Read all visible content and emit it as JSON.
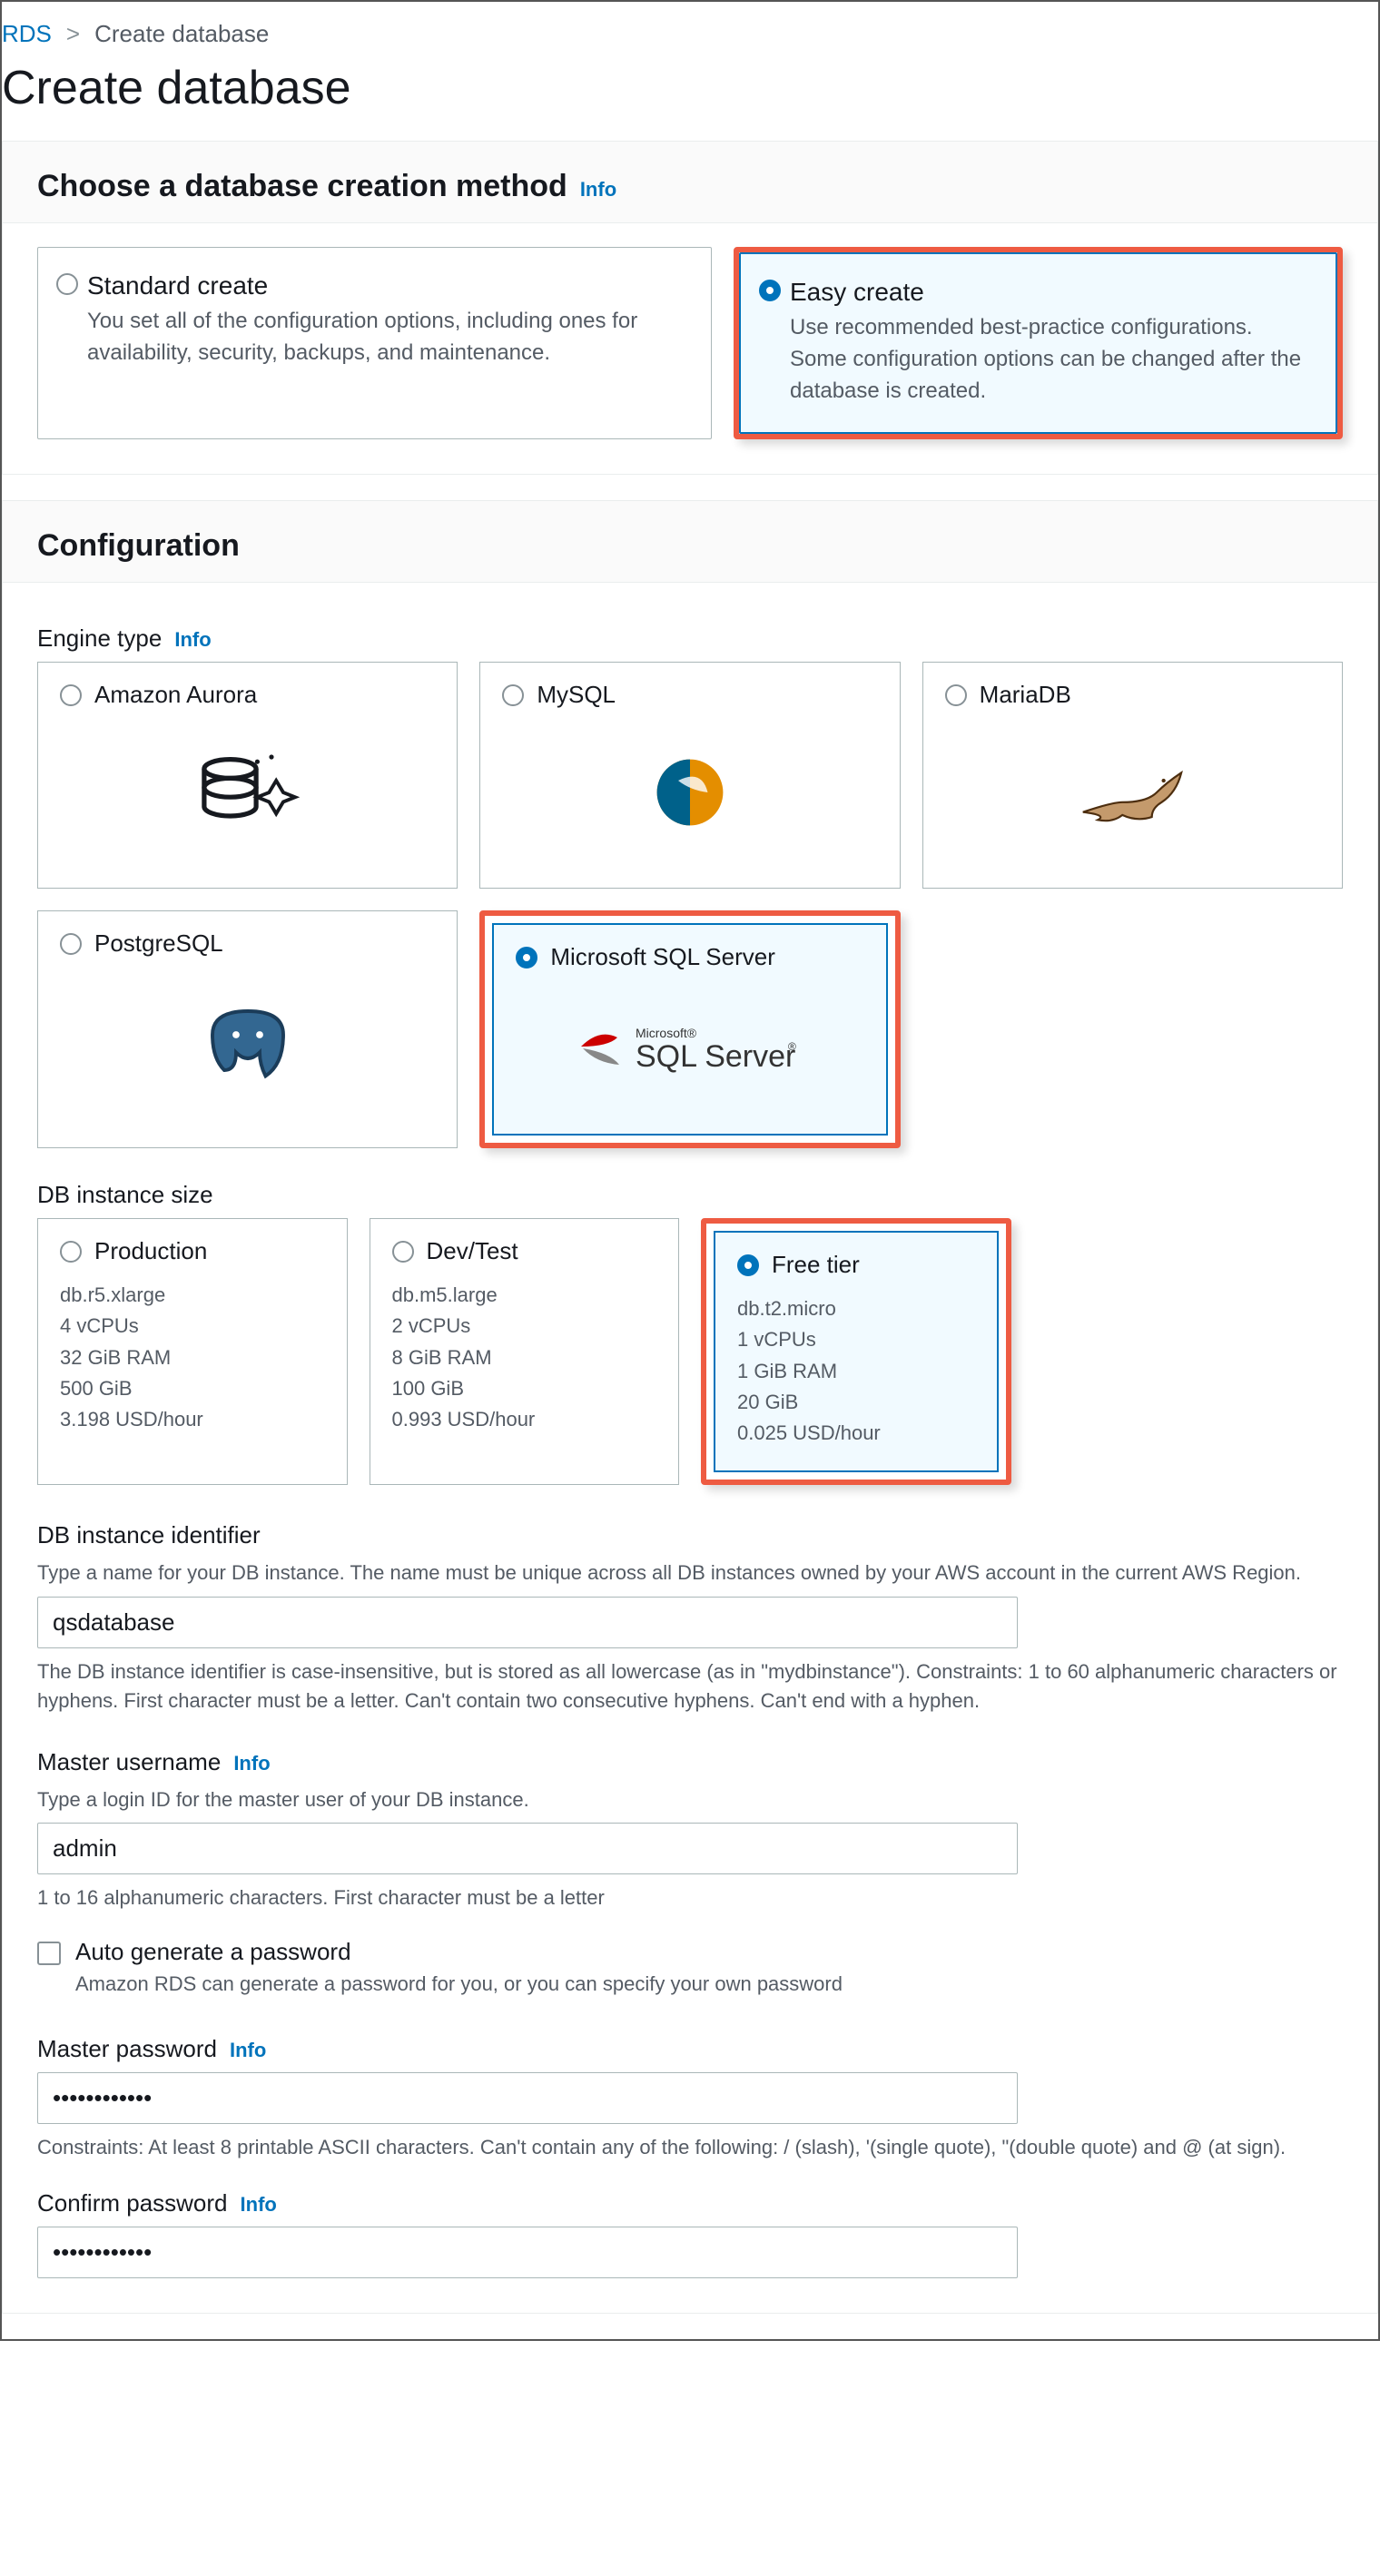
{
  "breadcrumb": {
    "root": "RDS",
    "current": "Create database"
  },
  "page_title": "Create database",
  "method_panel": {
    "heading": "Choose a database creation method",
    "info": "Info",
    "options": [
      {
        "title": "Standard create",
        "desc": "You set all of the configuration options, including ones for availability, security, backups, and maintenance."
      },
      {
        "title": "Easy create",
        "desc": "Use recommended best-practice configurations. Some configuration options can be changed after the database is created."
      }
    ]
  },
  "config_panel": {
    "heading": "Configuration",
    "engine_label": "Engine type",
    "info": "Info",
    "engines": [
      {
        "name": "Amazon Aurora"
      },
      {
        "name": "MySQL"
      },
      {
        "name": "MariaDB"
      },
      {
        "name": "PostgreSQL"
      },
      {
        "name": "Microsoft SQL Server"
      }
    ],
    "size_label": "DB instance size",
    "sizes": [
      {
        "name": "Production",
        "spec": [
          "db.r5.xlarge",
          "4 vCPUs",
          "32 GiB RAM",
          "500 GiB",
          "3.198 USD/hour"
        ]
      },
      {
        "name": "Dev/Test",
        "spec": [
          "db.m5.large",
          "2 vCPUs",
          "8 GiB RAM",
          "100 GiB",
          "0.993 USD/hour"
        ]
      },
      {
        "name": "Free tier",
        "spec": [
          "db.t2.micro",
          "1 vCPUs",
          "1 GiB RAM",
          "20 GiB",
          "0.025 USD/hour"
        ]
      }
    ],
    "identifier": {
      "label": "DB instance identifier",
      "help": "Type a name for your DB instance. The name must be unique across all DB instances owned by your AWS account in the current AWS Region.",
      "value": "qsdatabase",
      "hint": "The DB instance identifier is case-insensitive, but is stored as all lowercase (as in \"mydbinstance\"). Constraints: 1 to 60 alphanumeric characters or hyphens. First character must be a letter. Can't contain two consecutive hyphens. Can't end with a hyphen."
    },
    "master_user": {
      "label": "Master username",
      "info": "Info",
      "help": "Type a login ID for the master user of your DB instance.",
      "value": "admin",
      "hint": "1 to 16 alphanumeric characters. First character must be a letter"
    },
    "auto_pw": {
      "label": "Auto generate a password",
      "help": "Amazon RDS can generate a password for you, or you can specify your own password"
    },
    "master_pw": {
      "label": "Master password",
      "info": "Info",
      "value": "••••••••••••",
      "hint": "Constraints: At least 8 printable ASCII characters. Can't contain any of the following: / (slash), '(single quote), \"(double quote) and @ (at sign)."
    },
    "confirm_pw": {
      "label": "Confirm password",
      "info": "Info",
      "value": "••••••••••••"
    }
  }
}
